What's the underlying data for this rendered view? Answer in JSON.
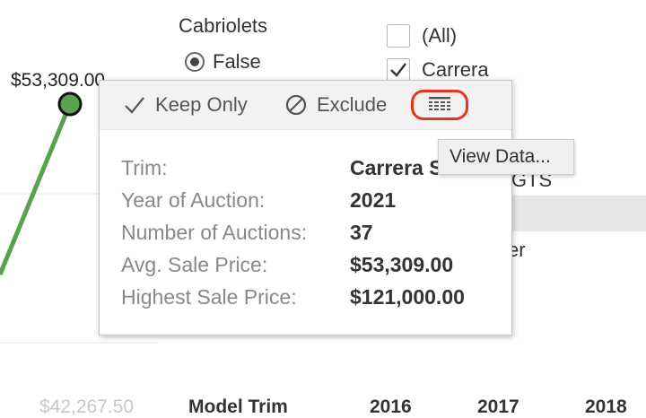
{
  "chart": {
    "point_label": "$53,309.00",
    "faded_value_label": "$42,267.50",
    "line_color": "#59a14f",
    "point_fill": "#59a14f"
  },
  "table_header": {
    "model_trim": "Model Trim",
    "years": [
      "2016",
      "2017",
      "2018"
    ]
  },
  "filters": {
    "cabriolets": {
      "title": "Cabriolets",
      "selected_option": "False"
    },
    "model_trim": {
      "options": [
        {
          "label": "(All)",
          "checked": false
        },
        {
          "label": "Carrera",
          "checked": true
        }
      ],
      "obscured_fragments": [
        "GTS",
        "er"
      ]
    }
  },
  "tooltip": {
    "toolbar": {
      "keep_only": "Keep Only",
      "exclude": "Exclude",
      "view_data_tooltip": "View Data..."
    },
    "rows": [
      {
        "label": "Trim:",
        "value": "Carrera S"
      },
      {
        "label": "Year of Auction:",
        "value": "2021"
      },
      {
        "label": "Number of Auctions:",
        "value": "37"
      },
      {
        "label": "Avg. Sale Price:",
        "value": "$53,309.00"
      },
      {
        "label": "Highest Sale Price:",
        "value": "$121,000.00"
      }
    ]
  },
  "colors": {
    "highlight_ring": "#e8341c",
    "row_highlight": "#e6e6e6"
  }
}
